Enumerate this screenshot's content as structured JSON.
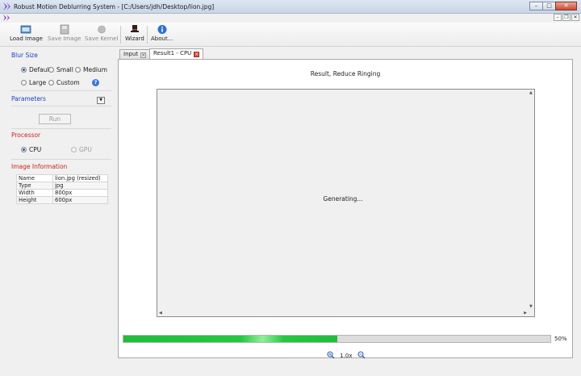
{
  "window": {
    "title": "Robust Motion Deblurring System - [C:/Users/jdh/Desktop/lion.jpg]"
  },
  "toolbar": {
    "load_image": "Load Image",
    "save_image": "Save Image",
    "save_kernel": "Save Kernel",
    "wizard": "Wizard",
    "about": "About..."
  },
  "blur_size": {
    "title": "Blur Size",
    "options": [
      "Default",
      "Small",
      "Medium",
      "Large",
      "Custom"
    ],
    "selected": "Default"
  },
  "parameters": {
    "title": "Parameters",
    "run_label": "Run"
  },
  "processor": {
    "title": "Processor",
    "cpu": "CPU",
    "gpu": "GPU",
    "selected": "CPU"
  },
  "image_info": {
    "title": "Image Information",
    "rows": [
      {
        "key": "Name",
        "value": "lion.jpg (resized)"
      },
      {
        "key": "Type",
        "value": "jpg"
      },
      {
        "key": "Width",
        "value": "800px"
      },
      {
        "key": "Height",
        "value": "600px"
      }
    ]
  },
  "tabs": [
    {
      "label": "Input",
      "active": false
    },
    {
      "label": "Result1 - CPU",
      "active": true
    }
  ],
  "result": {
    "title": "Result, Reduce Ringing",
    "status": "Generating...",
    "progress_percent": 50,
    "progress_label": "50%",
    "zoom_label": "1.0x"
  },
  "colors": {
    "accent_blue": "#1a3ec8",
    "accent_red": "#c8241a",
    "progress_green": "#24c83f"
  }
}
